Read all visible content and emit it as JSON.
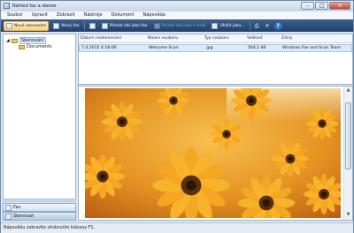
{
  "window": {
    "title": "Náhled fax a skener",
    "minimize": "–",
    "maximize": "□",
    "close": "✕"
  },
  "menu": [
    "Soubor",
    "Upravit",
    "Zobrazit",
    "Nástroje",
    "Dokument",
    "Nápověda"
  ],
  "toolbar": {
    "new_scan": "Nové skenování",
    "new_fax": "Nový fax",
    "forward_fax": "Předat dál jako fax",
    "forward_email": "Předat dál jako e-mail",
    "save_as": "Uložit jako...",
    "print": "⎙",
    "delete": "✕",
    "help": "?"
  },
  "tree": {
    "root": "Skenování",
    "child": "Documents"
  },
  "nav": {
    "fax": "Fax",
    "scan": "Skenovat"
  },
  "columns": [
    "Datum naskenování",
    "Název souboru",
    "Typ souboru",
    "Velikost",
    "Zdroj"
  ],
  "rows": [
    {
      "date": "7.4.2015 4:18:06",
      "name": "Welcome Scan",
      "type": ".jpg",
      "size": "504,1 kB",
      "source": "Windows Fax and Scan Team"
    }
  ],
  "status": "Nápovědu zobrazíte stisknutím klávesy F1."
}
